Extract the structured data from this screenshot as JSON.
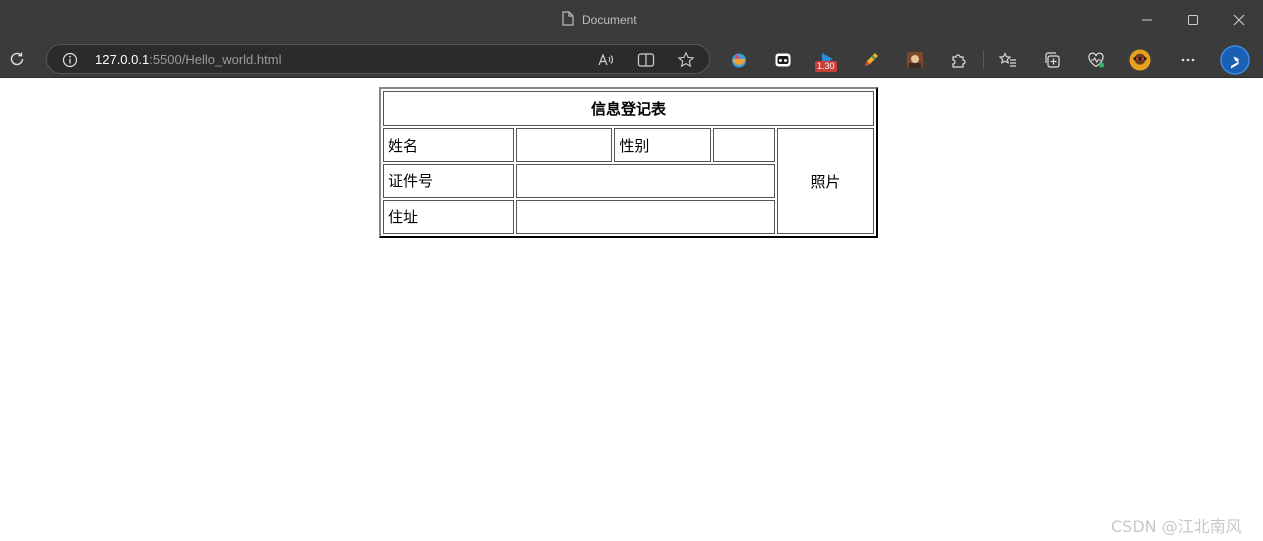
{
  "window": {
    "title": "Document"
  },
  "addressbar": {
    "url_host": "127.0.0.1",
    "url_rest": ":5500/Hello_world.html"
  },
  "extensions": {
    "badge_text": "1.30"
  },
  "form_table": {
    "title": "信息登记表",
    "name_label": "姓名",
    "gender_label": "性别",
    "id_label": "证件号",
    "address_label": "住址",
    "photo_label": "照片"
  },
  "watermark": "CSDN @江北南风"
}
